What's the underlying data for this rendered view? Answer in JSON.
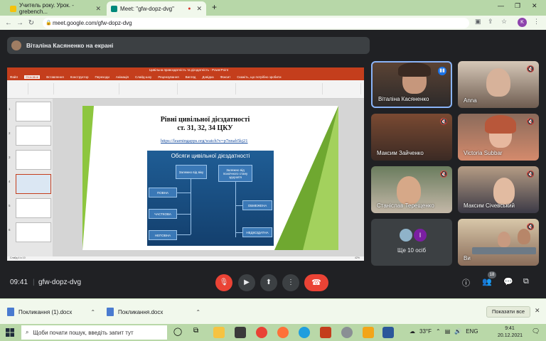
{
  "browser": {
    "tabs": [
      {
        "title": "Учитель року. Урок. - grebench...",
        "active": false
      },
      {
        "title": "Meet: \"gfw-dopz-dvg\"",
        "active": true
      }
    ],
    "url": "meet.google.com/gfw-dopz-dvg",
    "profile_initial": "K"
  },
  "meet": {
    "presenting_banner": "Віталіна Касяненко на екрані",
    "clock": "09:41",
    "meeting_code": "gfw-dopz-dvg",
    "participant_count": "18",
    "more_people_label": "Ще 10 осіб",
    "more_people_avatar": "I",
    "participants": [
      {
        "name": "Віталіна Касяненко",
        "speaking": true
      },
      {
        "name": "Anna"
      },
      {
        "name": "Максим Зайченко"
      },
      {
        "name": "Victoria Subbar"
      },
      {
        "name": "Станіслав Терещенко"
      },
      {
        "name": "Максим Січевський"
      },
      {
        "name": "Ви"
      }
    ]
  },
  "presentation": {
    "window_title": "Цивільна правоздатність та дієздатність - PowerPoint",
    "ribbon_tabs": [
      "Файл",
      "Основне",
      "Вставлення",
      "Конструктор",
      "Переходи",
      "Анімація",
      "Слайд-шоу",
      "Рецензування",
      "Вигляд",
      "Довідка",
      "Фоксит"
    ],
    "ribbon_search": "Скажіть, що потрібно зробити",
    "slide": {
      "title_line1": "Рівні цивільної дієздатності",
      "title_line2": "ст. 31, 32, 34 ЦКУ",
      "link": "https://learningapps.org/watch?v=p7nnab5kj21",
      "diagram_title": "Обсяги цивільної дієздатності",
      "boxes": {
        "by_age": "Залежно від віку",
        "by_mental": "Залежно від психічного стану здоров'я",
        "full": "ПОВНА",
        "partial": "ЧАСТКОВА",
        "incomplete": "НЕПОВНА",
        "limited": "ОБМЕЖЕНА",
        "incapable": "НЕДІЄЗДАТНА"
      }
    },
    "status_left": "Слайд 4 із 10",
    "zoom": "42%"
  },
  "downloads": {
    "items": [
      "Покликання (1).docx",
      "Покликання.docx"
    ],
    "show_all": "Показати все"
  },
  "taskbar": {
    "search_placeholder": "Щоби почати пошук, введіть запит тут",
    "weather": "33°F",
    "lang": "ENG",
    "time": "9:41",
    "date": "20.12.2021"
  },
  "colors": {
    "ppt_accent": "#c43e1c",
    "meet_bg": "#202124",
    "hangup": "#ea4335",
    "chrome_theme": "#b7d7a8"
  }
}
